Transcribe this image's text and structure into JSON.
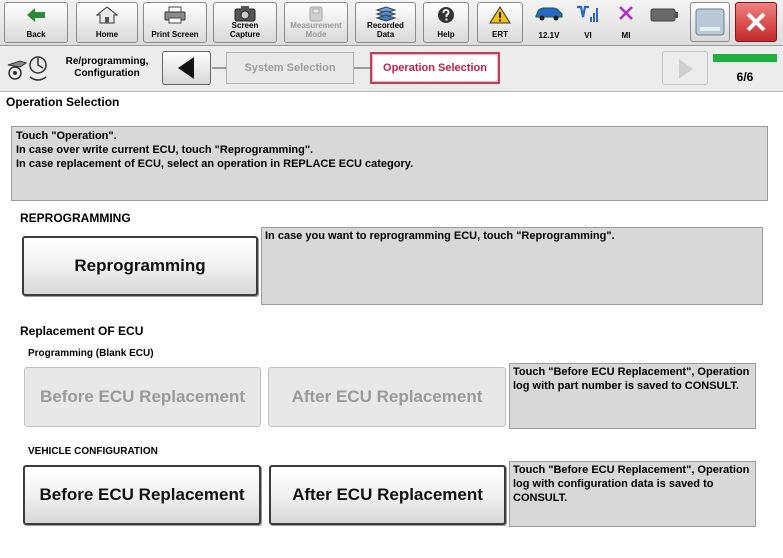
{
  "toolbar": {
    "back": "Back",
    "home": "Home",
    "print_screen": "Print Screen",
    "screen_capture": "Screen Capture",
    "measurement_mode": "Measurement Mode",
    "recorded_data": "Recorded Data",
    "help": "Help",
    "ert": "ERT",
    "voltage": "12.1V",
    "vi": "VI",
    "mi": "MI"
  },
  "breadcrumb": {
    "label": "Re/programming, Configuration",
    "steps": [
      {
        "label": "System Selection",
        "state": "inactive"
      },
      {
        "label": "Operation Selection",
        "state": "active"
      }
    ],
    "page": "6/6"
  },
  "page_title": "Operation Selection",
  "instructions": [
    "Touch \"Operation\".",
    "In case over write current ECU, touch \"Reprogramming\".",
    "In case replacement of ECU, select an operation in REPLACE ECU category."
  ],
  "reprogramming": {
    "title": "REPROGRAMMING",
    "button": "Reprogramming",
    "description": "In case you want to reprogramming ECU, touch \"Reprogramming\"."
  },
  "replacement": {
    "title": "Replacement OF ECU",
    "programming": {
      "label": "Programming (Blank ECU)",
      "before": "Before ECU Replacement",
      "after": "After ECU Replacement",
      "description": "Touch \"Before ECU Replacement\", Operation log with part number is saved to CONSULT."
    },
    "vehicle_config": {
      "label": "VEHICLE CONFIGURATION",
      "before": "Before ECU Replacement",
      "after": "After ECU Replacement",
      "description": "Touch \"Before ECU Replacement\", Operation log with configuration data is saved to CONSULT."
    }
  },
  "colors": {
    "active_step_border": "#c0405c",
    "progress_bar": "#20b040",
    "close_button": "#d8393a",
    "warning_icon": "#f2c200",
    "signal_icon": "#2a66c8",
    "mi_icon": "#b030c8"
  }
}
